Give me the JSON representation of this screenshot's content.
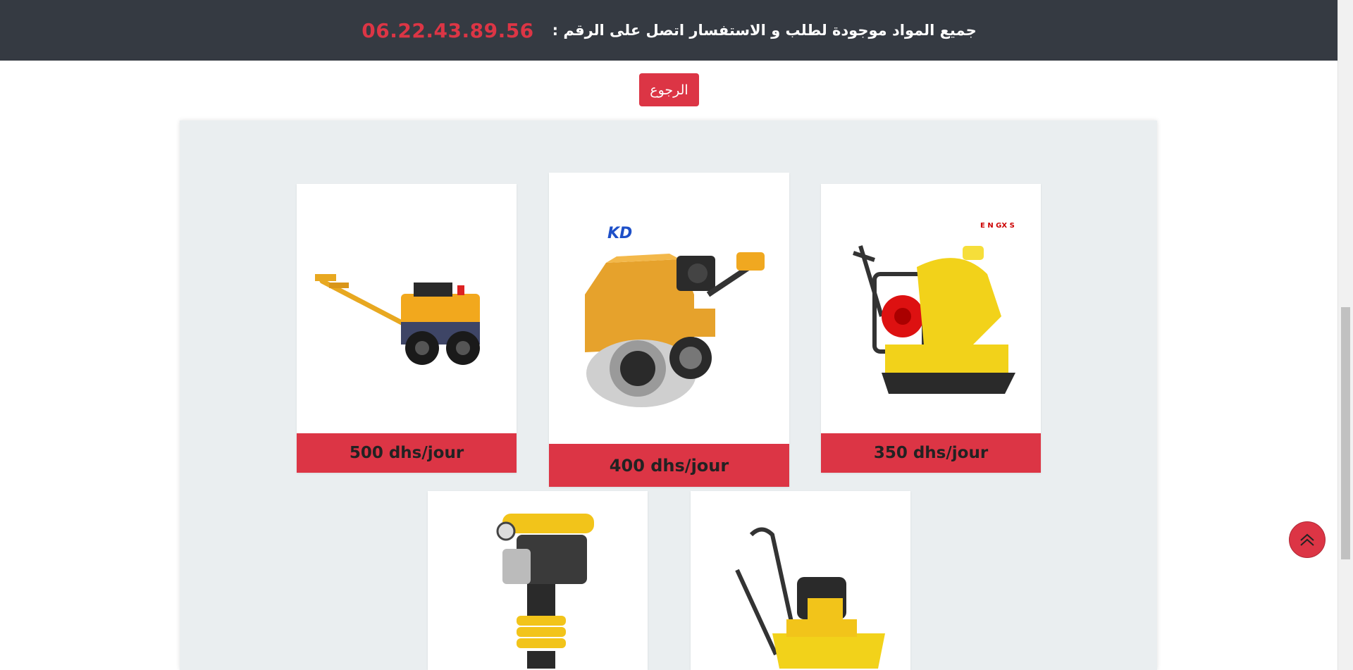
{
  "topbar": {
    "message": "جميع المواد موجودة لطلب و الاستفسار اتصل على الرقم :",
    "phone": "06.22.43.89.56"
  },
  "back_button": {
    "label": "الرجوع"
  },
  "products": [
    {
      "name": "walk-behind-roller-small",
      "price": "500 dhs/jour"
    },
    {
      "name": "double-drum-roller",
      "price": "400 dhs/jour",
      "logo_text": "KD"
    },
    {
      "name": "plate-compactor",
      "price": "350 dhs/jour",
      "logo_text": "E N GX S"
    },
    {
      "name": "rammer",
      "price": ""
    },
    {
      "name": "plate-compactor-2",
      "price": ""
    }
  ],
  "colors": {
    "topbar_bg": "#353a42",
    "accent": "#dc3545",
    "panel_bg": "#eaeef0"
  },
  "icons": {
    "scroll_top": "double-chevron-up-icon"
  }
}
